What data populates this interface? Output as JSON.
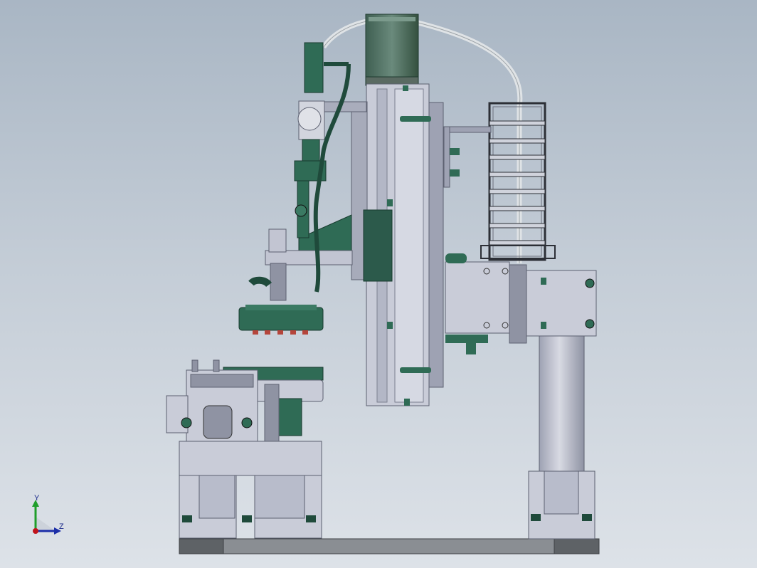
{
  "viewport": {
    "background_top": "#a9b6c4",
    "background_bottom": "#dde2e8"
  },
  "colors": {
    "steel": "#c9ccd8",
    "steel_dark": "#8f93a3",
    "steel_shadow": "#6b6f7c",
    "green": "#2f6b55",
    "green_dark": "#1f4a3b",
    "base_dark": "#5e6266",
    "cable": "#e8ecef"
  },
  "triad": {
    "y_label": "Y",
    "z_label": "Z",
    "y_color": "#1f9e2a",
    "z_color": "#1c2fa8",
    "origin_color": "#c0141c"
  },
  "parts": [
    "base-plate",
    "servo-motor",
    "vertical-slide",
    "drag-chain",
    "support-column",
    "column-bracket",
    "gripper-head",
    "cylinder-assembly",
    "fixture-station"
  ]
}
